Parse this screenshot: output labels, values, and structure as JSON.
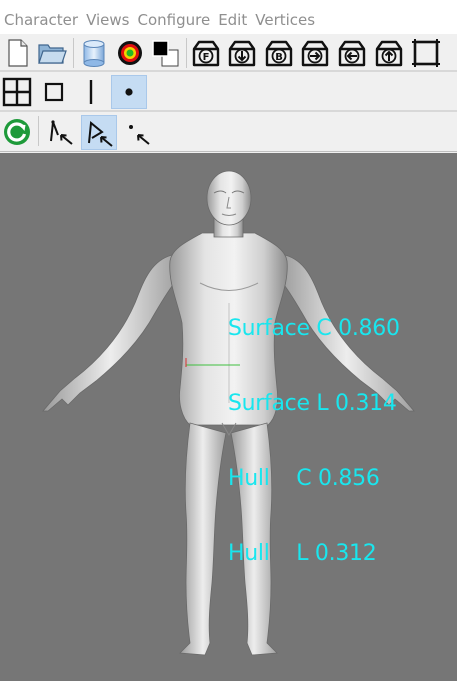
{
  "menu": {
    "items": [
      "Character",
      "Views",
      "Configure",
      "Edit",
      "Vertices"
    ]
  },
  "toolbar1": {
    "icons": [
      "new-file-icon",
      "open-folder-icon",
      "cylinder-icon",
      "color-ring-icon",
      "color-swatch-icon",
      "view-front-icon",
      "view-top-icon",
      "view-back-icon",
      "view-right-icon",
      "view-left-icon",
      "view-bottom-icon",
      "frame-icon"
    ],
    "letters": {
      "front": "F",
      "back": "B"
    }
  },
  "toolbar2": {
    "icons": [
      "quad-view-icon",
      "single-view-icon",
      "line-mode-icon",
      "point-mode-icon"
    ],
    "active": "point-mode-icon"
  },
  "toolbar3": {
    "icons": [
      "refresh-icon",
      "select-vertex-icon",
      "select-edge-icon",
      "select-point-icon"
    ],
    "active": "select-edge-icon"
  },
  "viewport": {
    "background": "#767676",
    "stats_color": "#19e6ee",
    "stats": [
      "Surface C 0.860",
      "Surface L 0.314",
      "Hull    C 0.856",
      "Hull    L 0.312"
    ]
  }
}
